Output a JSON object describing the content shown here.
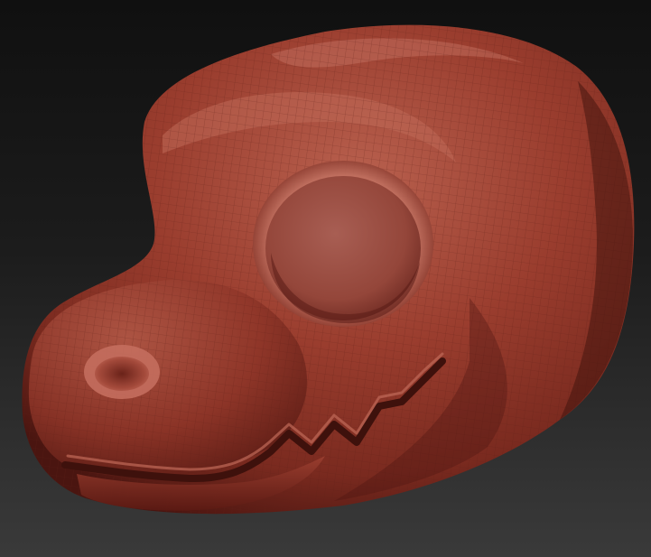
{
  "scene": {
    "subject_icon": "sculpt-head-icon",
    "colors": {
      "background_top": "#101010",
      "background_bottom": "#3a3a3a",
      "clay_base": "#8a3226",
      "clay_highlight": "#b9614f",
      "clay_shadow": "#4a1510",
      "wire_lines": "#5e2018"
    }
  }
}
